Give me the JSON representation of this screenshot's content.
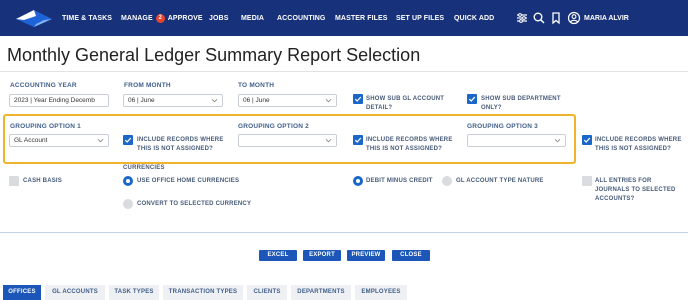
{
  "nav": {
    "items": [
      "TIME & TASKS",
      "MANAGE",
      "APPROVE",
      "JOBS",
      "MEDIA",
      "ACCOUNTING",
      "MASTER FILES",
      "SET UP FILES",
      "QUICK ADD"
    ],
    "manage_badge": "2",
    "user_name": "MARIA ALVIR",
    "brand_color": "#17327a"
  },
  "page": {
    "title": "Monthly General Ledger Summary Report Selection"
  },
  "form": {
    "accounting_year_label": "ACCOUNTING YEAR",
    "accounting_year_value": "2023 | Year Ending Decemb",
    "from_month_label": "FROM MONTH",
    "from_month_value": "06 | June",
    "to_month_label": "TO MONTH",
    "to_month_value": "06 | June",
    "show_sub_gl_label_1": "SHOW SUB GL ACCOUNT",
    "show_sub_gl_label_2": "DETAIL?",
    "show_sub_gl_checked": true,
    "show_sub_dept_label_1": "SHOW SUB DEPARTMENT",
    "show_sub_dept_label_2": "ONLY?",
    "show_sub_dept_checked": true,
    "grouping1_label": "GROUPING OPTION 1",
    "grouping1_value": "GL Account",
    "grouping2_label": "GROUPING OPTION 2",
    "grouping2_value": "",
    "grouping3_label": "GROUPING OPTION 3",
    "grouping3_value": "",
    "include_unassigned_1": "INCLUDE RECORDS WHERE",
    "include_unassigned_2": "THIS IS NOT ASSIGNED?",
    "currencies_label": "CURRENCIES",
    "cash_basis_label": "CASH BASIS",
    "cash_basis_checked": false,
    "use_office_currency_label": "USE OFFICE HOME CURRENCIES",
    "convert_currency_label": "CONVERT TO SELECTED CURRENCY",
    "debit_minus_credit_label": "DEBIT MINUS CREDIT",
    "gl_account_type_label": "GL ACCOUNT TYPE NATURE",
    "all_entries_label_1": "ALL ENTRIES FOR",
    "all_entries_label_2": "JOURNALS TO SELECTED",
    "all_entries_label_3": "ACCOUNTS?",
    "all_entries_checked": false
  },
  "actions": {
    "excel": "EXCEL",
    "export": "EXPORT",
    "preview": "PREVIEW",
    "close": "CLOSE"
  },
  "tabs": [
    "OFFICES",
    "GL ACCOUNTS",
    "TASK TYPES",
    "TRANSACTION TYPES",
    "CLIENTS",
    "DEPARTMENTS",
    "EMPLOYEES"
  ],
  "active_tab": "OFFICES",
  "colors": {
    "accent": "#1b66c9",
    "highlight": "#f0b42c"
  }
}
